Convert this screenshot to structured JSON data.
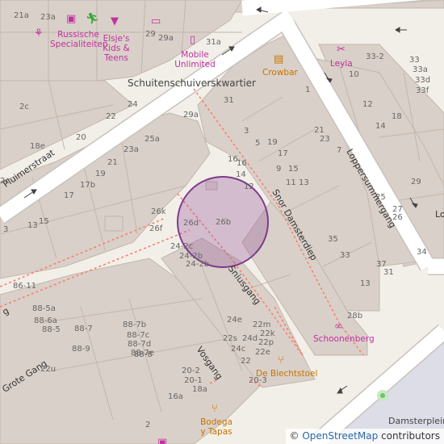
{
  "map": {
    "place_label": "Schuitenschuiverskwartier",
    "square_label": "Damsterplein",
    "streets": {
      "pluimerstraat": "Pluimerstraat",
      "loppersummergang": "Loppersummergang",
      "snor_damsterdiep": "Snor Damsterdiep",
      "sniusgang": "Sniusgang",
      "vosgang": "Vosgang",
      "grote_gang": "Grote Gang",
      "left_fragment": "g",
      "right_fragment": "Lo"
    },
    "pois": {
      "russische": "Russische Specialiteiten",
      "elsjes": "Elsje's Kids & Teens",
      "mobile": "Mobile Unlimited",
      "crowbar": "Crowbar",
      "leyla": "Leyla",
      "schoonenberg": "Schoonenberg",
      "biechtstoel": "De Biechtstoel",
      "bodega": "Bodega y Tapas"
    },
    "house_numbers": [
      "21a",
      "23a",
      "29",
      "29a",
      "31a",
      "33-2",
      "33",
      "33a",
      "33d",
      "33f",
      "10",
      "1",
      "12",
      "14",
      "16",
      "18",
      "21",
      "23",
      "3",
      "5",
      "19",
      "7",
      "17",
      "9",
      "15",
      "11",
      "13",
      "25",
      "27",
      "29",
      "26",
      "35",
      "33",
      "37",
      "31",
      "34",
      "13",
      "28b",
      "31",
      "29a",
      "24",
      "22",
      "25a",
      "23a",
      "20",
      "18e",
      "21",
      "19",
      "17b",
      "17",
      "16",
      "14",
      "12",
      "26k",
      "26f",
      "26d",
      "26b",
      "24-2c",
      "24-2b",
      "24-2b",
      "15",
      "13",
      "86-11",
      "88-5a",
      "88-6a",
      "88-5",
      "88-7",
      "88-7b",
      "88-7c",
      "88-7d",
      "88-7e",
      "88-8",
      "88-9",
      "22u",
      "24e",
      "22m",
      "22s",
      "24d",
      "22k",
      "24c",
      "22p",
      "22e",
      "22",
      "20-3",
      "20-2",
      "20-1",
      "18a",
      "16a",
      "2",
      "2c",
      "2c",
      "3"
    ]
  },
  "attribution": {
    "copyright": "©",
    "link_text": "OpenStreetMap",
    "suffix": "contributors"
  },
  "colors": {
    "background": "#f2efe9",
    "building": "#d9d0c9",
    "building_stroke": "#c4b6ab",
    "road": "#ffffff",
    "pedestrian": "#dddde8",
    "footway": "#fa8072",
    "marker_fill": "#9b5f9b",
    "marker_stroke": "#7d3c8c",
    "poi_pink": "#c1319f",
    "poi_orange": "#c77400",
    "park_dot": "#6fc26f"
  },
  "icons": {
    "russische": "perfume-icon",
    "elsjes": "clothing-icon",
    "mobile": "phone-icon",
    "crowbar": "beer-icon",
    "leyla": "boutique-icon",
    "schoonenberg": "optician-icon",
    "biechtstoel": "restaurant-icon",
    "bodega": "restaurant-icon",
    "runner": "sports-icon",
    "laptop": "computer-icon",
    "hair": "hairdresser-icon",
    "gift": "gift-icon"
  }
}
